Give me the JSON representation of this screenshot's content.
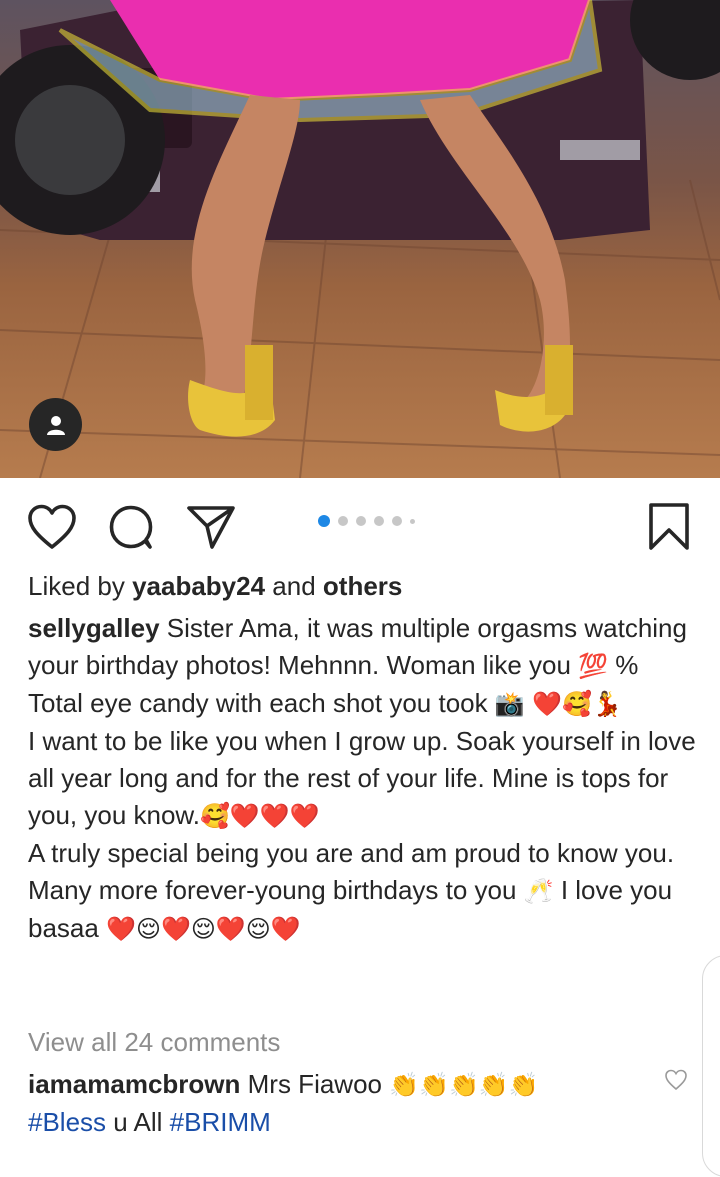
{
  "post": {
    "liked": {
      "prefix": "Liked by",
      "user": "yaababy24",
      "middle": "and",
      "others": "others"
    },
    "caption": {
      "username": "sellygalley",
      "line1": "Sister Ama, it was multiple orgasms watching your birthday photos! Mehnnn. Woman like you",
      "emoji_100": "💯",
      "line1b": "% Total eye candy with each shot you took",
      "emoji_a": "📸 ❤️🥰💃",
      "line2": "I want to be like you when I grow up. Soak yourself in love all year long and for the rest of your life. Mine is tops for you, you know.",
      "emoji_b": "🥰❤️❤️❤️",
      "line3": "A truly special being you are and am proud to know you.",
      "line4": "Many more forever-young birthdays to you",
      "emoji_c": "🥂",
      "line4b": "I love you basaa",
      "emoji_d": "❤️😌❤️😌❤️😌❤️"
    },
    "view_all": "View all 24 comments",
    "comment": {
      "username": "iamamamcbrown",
      "text": "Mrs Fiawoo",
      "emoji": "👏👏👏👏👏",
      "tag1": "#Bless",
      "mid": "u All",
      "tag2": "#BRIMM"
    },
    "carousel": {
      "count": 6,
      "active_index": 0
    },
    "icons": {
      "like": "heart-icon",
      "comment": "comment-bubble-icon",
      "share": "paper-plane-icon",
      "save": "bookmark-icon",
      "avatar": "user-avatar-icon"
    }
  }
}
